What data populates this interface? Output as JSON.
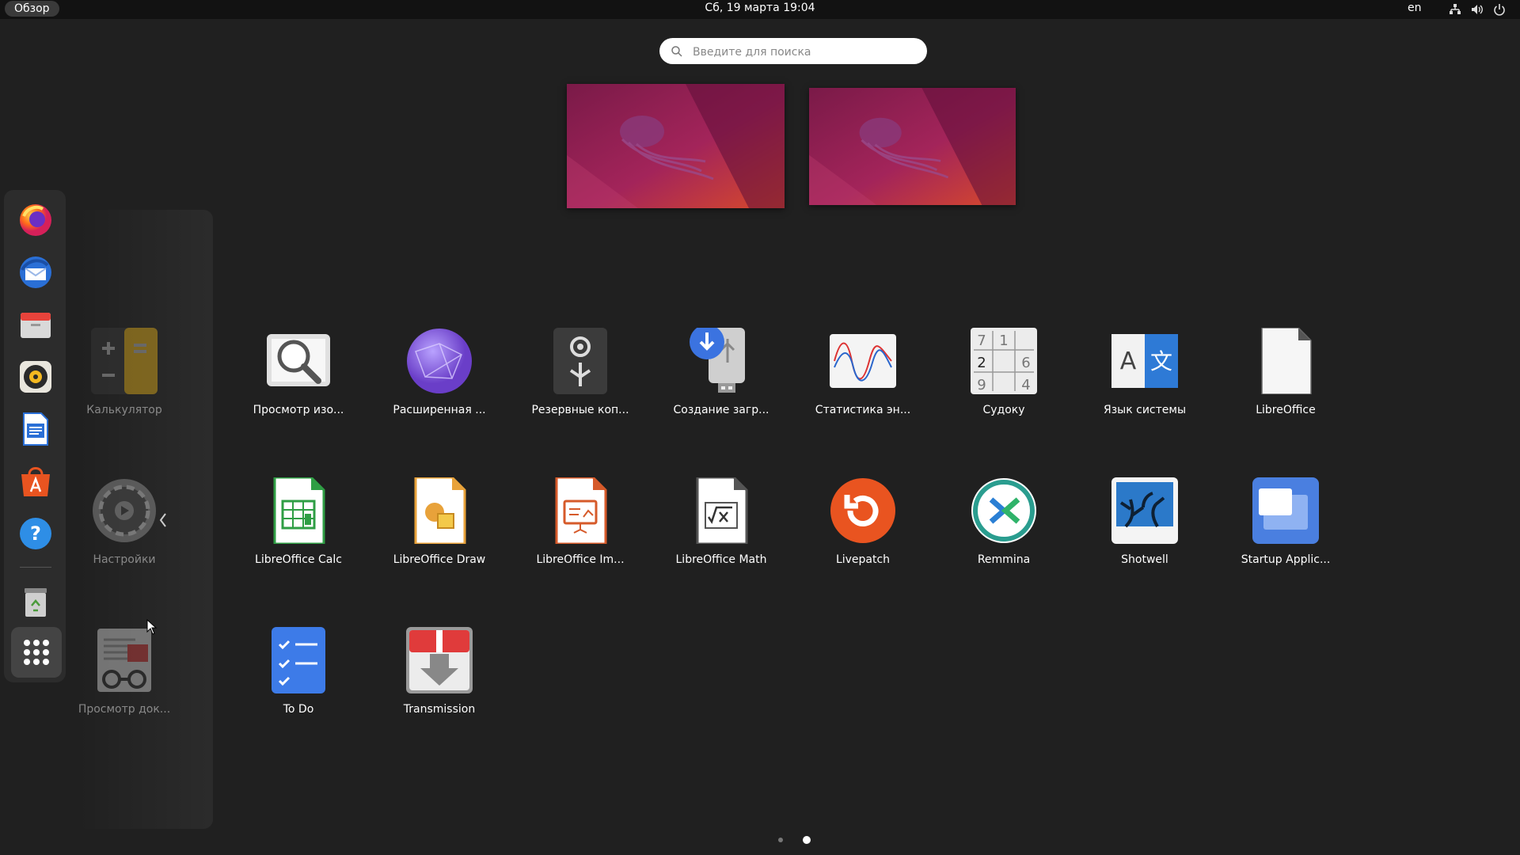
{
  "topbar": {
    "overview_label": "Обзор",
    "clock": "Сб, 19 марта  19:04",
    "language": "en",
    "tray_icons": [
      "network-icon",
      "volume-icon",
      "power-icon"
    ]
  },
  "search": {
    "placeholder": "Введите для поиска"
  },
  "dock": {
    "items": [
      {
        "name": "firefox",
        "icon": "firefox-icon"
      },
      {
        "name": "thunderbird",
        "icon": "thunderbird-icon"
      },
      {
        "name": "files",
        "icon": "files-icon"
      },
      {
        "name": "rhythmbox",
        "icon": "rhythmbox-icon"
      },
      {
        "name": "libreoffice-writer",
        "icon": "writer-icon"
      },
      {
        "name": "ubuntu-software",
        "icon": "software-icon"
      },
      {
        "name": "help",
        "icon": "help-icon"
      },
      {
        "name": "trash",
        "icon": "trash-icon"
      },
      {
        "name": "show-applications",
        "icon": "apps-grid-icon"
      }
    ]
  },
  "folder": {
    "apps": [
      {
        "label": "Калькулятор",
        "icon": "calculator-icon"
      },
      {
        "label": "Настройки",
        "icon": "settings-icon"
      },
      {
        "label": "Просмотр док...",
        "icon": "document-viewer-icon"
      }
    ]
  },
  "apps": [
    {
      "label": "Просмотр изо...",
      "icon": "image-viewer-icon"
    },
    {
      "label": "Расширенная ...",
      "icon": "advanced-network-icon"
    },
    {
      "label": "Резервные коп...",
      "icon": "backups-icon"
    },
    {
      "label": "Создание загр...",
      "icon": "startup-disk-creator-icon"
    },
    {
      "label": "Статистика эн...",
      "icon": "power-statistics-icon"
    },
    {
      "label": "Судоку",
      "icon": "sudoku-icon"
    },
    {
      "label": "Язык системы",
      "icon": "language-support-icon"
    },
    {
      "label": "LibreOffice",
      "icon": "libreoffice-icon"
    },
    {
      "label": "LibreOffice Calc",
      "icon": "libreoffice-calc-icon"
    },
    {
      "label": "LibreOffice Draw",
      "icon": "libreoffice-draw-icon"
    },
    {
      "label": "LibreOffice Im...",
      "icon": "libreoffice-impress-icon"
    },
    {
      "label": "LibreOffice Math",
      "icon": "libreoffice-math-icon"
    },
    {
      "label": "Livepatch",
      "icon": "livepatch-icon"
    },
    {
      "label": "Remmina",
      "icon": "remmina-icon"
    },
    {
      "label": "Shotwell",
      "icon": "shotwell-icon"
    },
    {
      "label": "Startup Applic...",
      "icon": "startup-applications-icon"
    },
    {
      "label": "To Do",
      "icon": "todo-icon"
    },
    {
      "label": "Transmission",
      "icon": "transmission-icon"
    }
  ],
  "sudoku_digits": [
    "7",
    "1",
    "2",
    "6",
    "9",
    "4"
  ],
  "language_letters": [
    "A",
    "文"
  ],
  "pagination": {
    "pages": 2,
    "current": 2
  },
  "colors": {
    "background": "#202020",
    "topbar": "#121212",
    "dock": "#2c2c2c",
    "accent_orange": "#e95420"
  }
}
